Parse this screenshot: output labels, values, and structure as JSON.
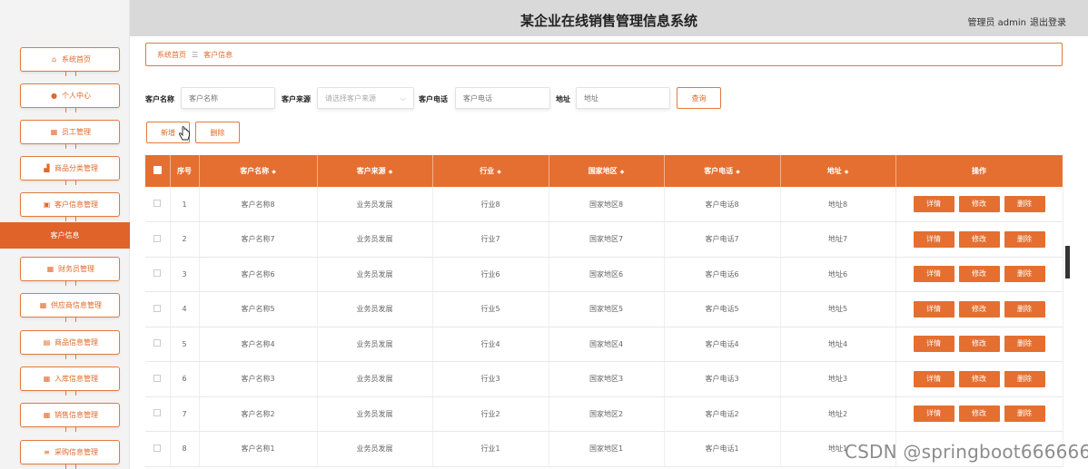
{
  "app": {
    "title": "某企业在线销售管理信息系统",
    "user": "管理员 admin",
    "logout": "退出登录"
  },
  "sidebar": {
    "items": [
      {
        "label": "系统首页",
        "icon": "home-icon",
        "glyph": "⌂"
      },
      {
        "label": "个人中心",
        "icon": "user-icon",
        "glyph": "●"
      },
      {
        "label": "员工管理",
        "icon": "grid-icon",
        "glyph": "▦"
      },
      {
        "label": "商品分类管理",
        "icon": "chart-icon",
        "glyph": "▟"
      },
      {
        "label": "客户信息管理",
        "icon": "card-icon",
        "glyph": "▣"
      },
      {
        "label": "财务员管理",
        "icon": "grid-icon",
        "glyph": "▦"
      },
      {
        "label": "供应商信息管理",
        "icon": "table-icon",
        "glyph": "▦"
      },
      {
        "label": "商品信息管理",
        "icon": "doc-icon",
        "glyph": "▤"
      },
      {
        "label": "入库信息管理",
        "icon": "grid-icon",
        "glyph": "▦"
      },
      {
        "label": "销售信息管理",
        "icon": "grid-icon",
        "glyph": "▦"
      },
      {
        "label": "采购信息管理",
        "icon": "list-icon",
        "glyph": "≡"
      }
    ],
    "active_sub": "客户信息"
  },
  "breadcrumb": {
    "home": "系统首页",
    "separator": "☰",
    "current": "客户信息"
  },
  "search": {
    "name_label": "客户名称",
    "name_placeholder": "客户名称",
    "source_label": "客户来源",
    "source_placeholder": "请选择客户来源",
    "phone_label": "客户电话",
    "phone_placeholder": "客户电话",
    "address_label": "地址",
    "address_placeholder": "地址",
    "query_button": "查询"
  },
  "actions": {
    "add": "新增",
    "delete": "删除"
  },
  "table": {
    "headers": [
      "序号",
      "客户名称",
      "客户来源",
      "行业",
      "国家地区",
      "客户电话",
      "地址",
      "操作"
    ],
    "sort_glyph": "◆",
    "rows": [
      {
        "index": "1",
        "name": "客户名称8",
        "source": "业务员发展",
        "industry": "行业8",
        "region": "国家地区8",
        "phone": "客户电话8",
        "address": "地址8"
      },
      {
        "index": "2",
        "name": "客户名称7",
        "source": "业务员发展",
        "industry": "行业7",
        "region": "国家地区7",
        "phone": "客户电话7",
        "address": "地址7"
      },
      {
        "index": "3",
        "name": "客户名称6",
        "source": "业务员发展",
        "industry": "行业6",
        "region": "国家地区6",
        "phone": "客户电话6",
        "address": "地址6"
      },
      {
        "index": "4",
        "name": "客户名称5",
        "source": "业务员发展",
        "industry": "行业5",
        "region": "国家地区5",
        "phone": "客户电话5",
        "address": "地址5"
      },
      {
        "index": "5",
        "name": "客户名称4",
        "source": "业务员发展",
        "industry": "行业4",
        "region": "国家地区4",
        "phone": "客户电话4",
        "address": "地址4"
      },
      {
        "index": "6",
        "name": "客户名称3",
        "source": "业务员发展",
        "industry": "行业3",
        "region": "国家地区3",
        "phone": "客户电话3",
        "address": "地址3"
      },
      {
        "index": "7",
        "name": "客户名称2",
        "source": "业务员发展",
        "industry": "行业2",
        "region": "国家地区2",
        "phone": "客户电话2",
        "address": "地址2"
      },
      {
        "index": "8",
        "name": "客户名称1",
        "source": "业务员发展",
        "industry": "行业1",
        "region": "国家地区1",
        "phone": "客户电话1",
        "address": "地址1"
      }
    ],
    "ops": {
      "detail": "详情",
      "edit": "修改",
      "delete": "删除"
    }
  },
  "watermark": "CSDN @springboot666666",
  "colors": {
    "accent": "#e56f30",
    "header_bg": "#d9d9d9",
    "sidebar_bg": "#f3f3f3"
  }
}
